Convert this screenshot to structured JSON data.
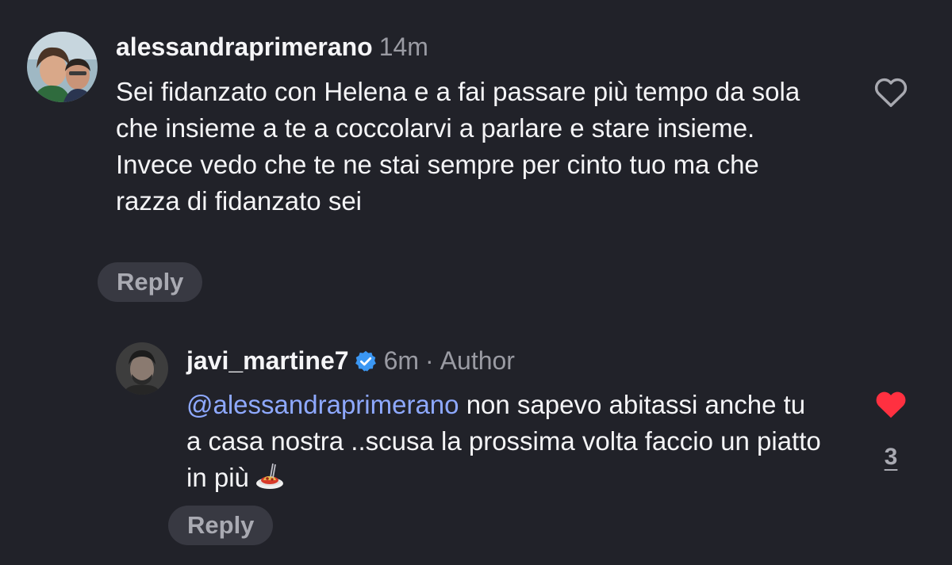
{
  "comments": [
    {
      "username": "alessandraprimerano",
      "time": "14m",
      "body": "Sei fidanzato con Helena e a fai passare più tempo da sola che insieme a te a coccolarvi a parlare e stare insieme. Invece vedo che te ne stai sempre per cinto tuo ma che razza di fidanzato sei",
      "reply_label": "Reply",
      "liked": false,
      "like_icon": "heart-outline-icon"
    }
  ],
  "replies": [
    {
      "username": "javi_martine7",
      "verified": true,
      "time": "6m",
      "separator": "·",
      "author_label": "Author",
      "mention": "@alessandraprimerano",
      "body": "non sapevo abitassi anche tu a casa nostra ..scusa la prossima volta faccio un piatto in più",
      "emoji": "spaghetti-icon",
      "reply_label": "Reply",
      "liked": true,
      "like_icon": "heart-filled-icon",
      "like_count": "3"
    }
  ],
  "colors": {
    "background": "#212229",
    "mention": "#8ea9ff",
    "verified": "#3b97f3",
    "liked_heart": "#ff3040",
    "meta_text": "#9a9ba3"
  }
}
